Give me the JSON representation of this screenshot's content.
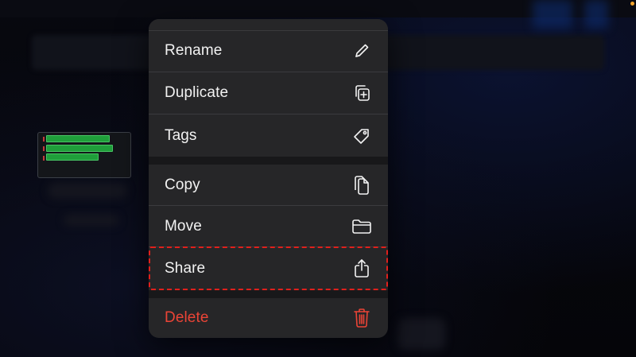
{
  "menu": {
    "items": [
      {
        "label": "Rename",
        "icon": "pencil-icon"
      },
      {
        "label": "Duplicate",
        "icon": "duplicate-icon"
      },
      {
        "label": "Tags",
        "icon": "tag-icon"
      },
      {
        "label": "Copy",
        "icon": "copy-icon"
      },
      {
        "label": "Move",
        "icon": "folder-icon"
      },
      {
        "label": "Share",
        "icon": "share-icon"
      },
      {
        "label": "Delete",
        "icon": "trash-icon"
      }
    ],
    "highlighted_item": "Share"
  },
  "colors": {
    "menu_background": "#262628",
    "menu_text": "#f2f2f2",
    "destructive": "#eb4436",
    "highlight_border": "#e0201c",
    "thumbnail_track": "#1f9e3a"
  }
}
